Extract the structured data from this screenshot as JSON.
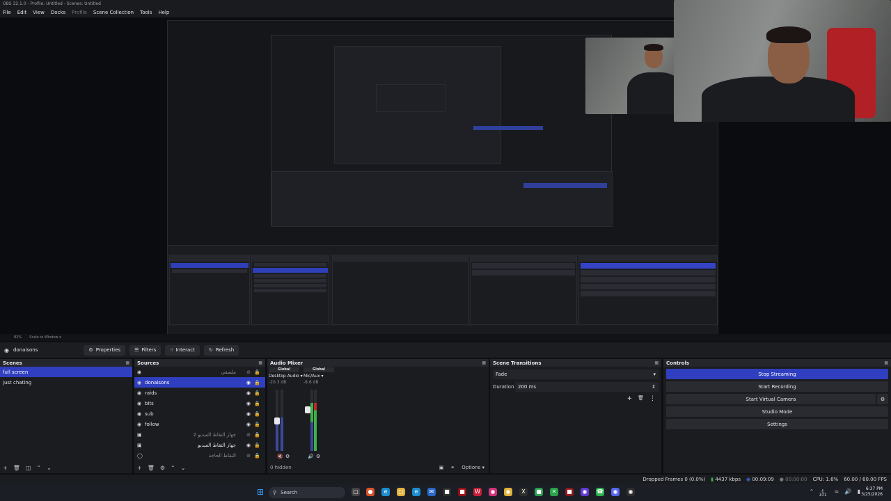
{
  "window": {
    "title": "OBS 32.1.0 - Profile: Untitled - Scenes: Untitled"
  },
  "menu": [
    "File",
    "Edit",
    "View",
    "Docks",
    "Profile",
    "Scene Collection",
    "Tools",
    "Help"
  ],
  "zoom": {
    "percent": "82%",
    "scale_label": "Scale to Window"
  },
  "scenebar": {
    "current_source": "donaisons",
    "buttons": {
      "properties": "Properties",
      "filters": "Filters",
      "interact": "Interact",
      "refresh": "Refresh"
    }
  },
  "scenes": {
    "title": "Scenes",
    "items": [
      "full screen",
      "just chating"
    ],
    "selected": "full screen"
  },
  "sources": {
    "title": "Sources",
    "items": [
      {
        "name": "ملصقي",
        "rtl": true,
        "dim": true
      },
      {
        "name": "donaisons",
        "selected": true
      },
      {
        "name": "raids"
      },
      {
        "name": "bits"
      },
      {
        "name": "sub"
      },
      {
        "name": "follow"
      },
      {
        "name": "جهاز التقاط الفيديو 2",
        "rtl": true,
        "dim": true
      },
      {
        "name": "جهاز التقاط الفيديو",
        "rtl": true
      },
      {
        "name": "التقاط الحاجة",
        "rtl": true,
        "dim": true
      }
    ]
  },
  "mixer": {
    "title": "Audio Mixer",
    "channels": [
      {
        "chip": "Global",
        "name": "Desktop Audio",
        "db": "-20.3 dB",
        "level": 0.55,
        "fader": 0.65
      },
      {
        "chip": "Global",
        "name": "Mic/Aux",
        "db": "-8.6 dB",
        "level": 0.78,
        "fader": 0.8
      }
    ],
    "hidden": "0 hidden",
    "options": "Options"
  },
  "transitions": {
    "title": "Scene Transitions",
    "type": "Fade",
    "duration_label": "Duration",
    "duration_value": "200 ms"
  },
  "controls": {
    "title": "Controls",
    "buttons": [
      "Stop Streaming",
      "Start Recording",
      "Start Virtual Camera",
      "Studio Mode",
      "Settings"
    ]
  },
  "status": {
    "dropped": "Dropped Frames 0 (0.0%)",
    "kbps": "4437 kbps",
    "stream_time": "00:09:09",
    "rec_time": "00:00:00",
    "cpu": "CPU: 1.6%",
    "fps": "60.00 / 60.00 FPS"
  },
  "taskbar": {
    "search": "Search",
    "time": "6:37 PM",
    "date": "3/25/2026",
    "lang": "ع",
    "lang2": "101"
  },
  "colors": {
    "accent": "#2f3fbf",
    "bg": "#1b1c20",
    "meter_green": "#3fb24a",
    "meter_red": "#c0262b"
  }
}
